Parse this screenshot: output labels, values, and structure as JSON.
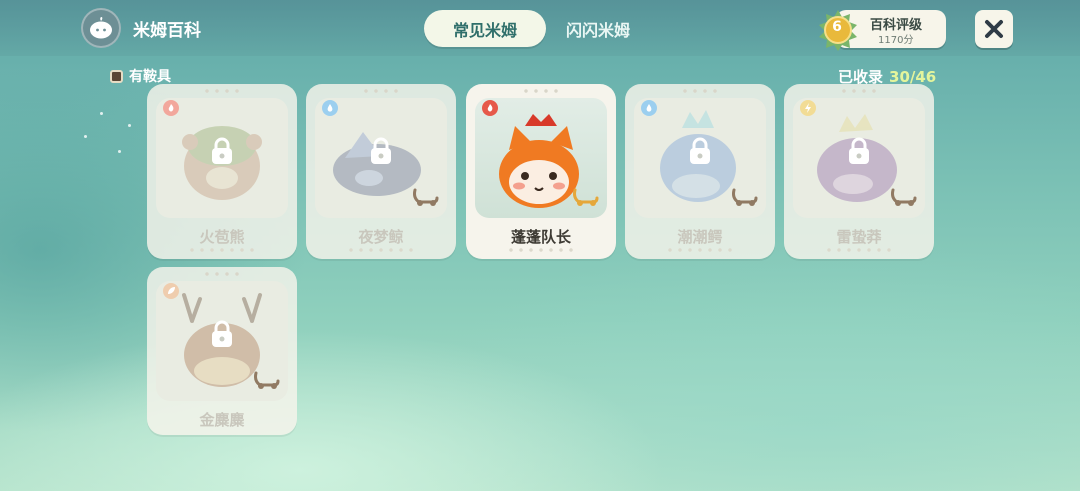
{
  "header": {
    "app_title": "米姆百科",
    "tabs": [
      {
        "label": "常见米姆",
        "active": true
      },
      {
        "label": "闪闪米姆",
        "active": false
      }
    ],
    "rating": {
      "title": "百科评级",
      "score": "1170分",
      "level": "6"
    }
  },
  "filter": {
    "saddle_label": "有鞍具",
    "checked": true
  },
  "collection": {
    "label": "已收录",
    "count": "30/46"
  },
  "cards": [
    {
      "name": "火苞熊",
      "element": "fire",
      "locked": true,
      "has_saddle": false,
      "body_color": "#b27a55",
      "accent": "#6f8f3c"
    },
    {
      "name": "夜梦鲸",
      "element": "water",
      "locked": true,
      "has_saddle": true,
      "body_color": "#3c4b7a",
      "accent": "#6b85c7"
    },
    {
      "name": "蓬蓬队长",
      "element": "fire",
      "locked": false,
      "has_saddle": true,
      "body_color": "#f07a22",
      "accent": "#d83a2a"
    },
    {
      "name": "潮潮鳄",
      "element": "water",
      "locked": true,
      "has_saddle": true,
      "body_color": "#5d8fd6",
      "accent": "#7ad0e0"
    },
    {
      "name": "雷蛰莽",
      "element": "electric",
      "locked": true,
      "has_saddle": true,
      "body_color": "#7a4a9a",
      "accent": "#e2d47a"
    },
    {
      "name": "金麋麋",
      "element": "grass",
      "locked": true,
      "has_saddle": true,
      "body_color": "#a3673d",
      "accent": "#e4c48a"
    }
  ],
  "icons": {
    "close": "close-icon",
    "lock": "lock-icon",
    "saddle": "saddle-icon",
    "fire": "fire-element-icon",
    "water": "water-element-icon",
    "electric": "electric-element-icon",
    "grass": "grass-element-icon"
  },
  "colors": {
    "tab_active_text": "#2f6f6a",
    "count_highlight": "#e4f59c",
    "fire": "#e6594a",
    "water": "#4aa7de",
    "electric": "#e7b93a",
    "grass": "#e6b48a"
  }
}
